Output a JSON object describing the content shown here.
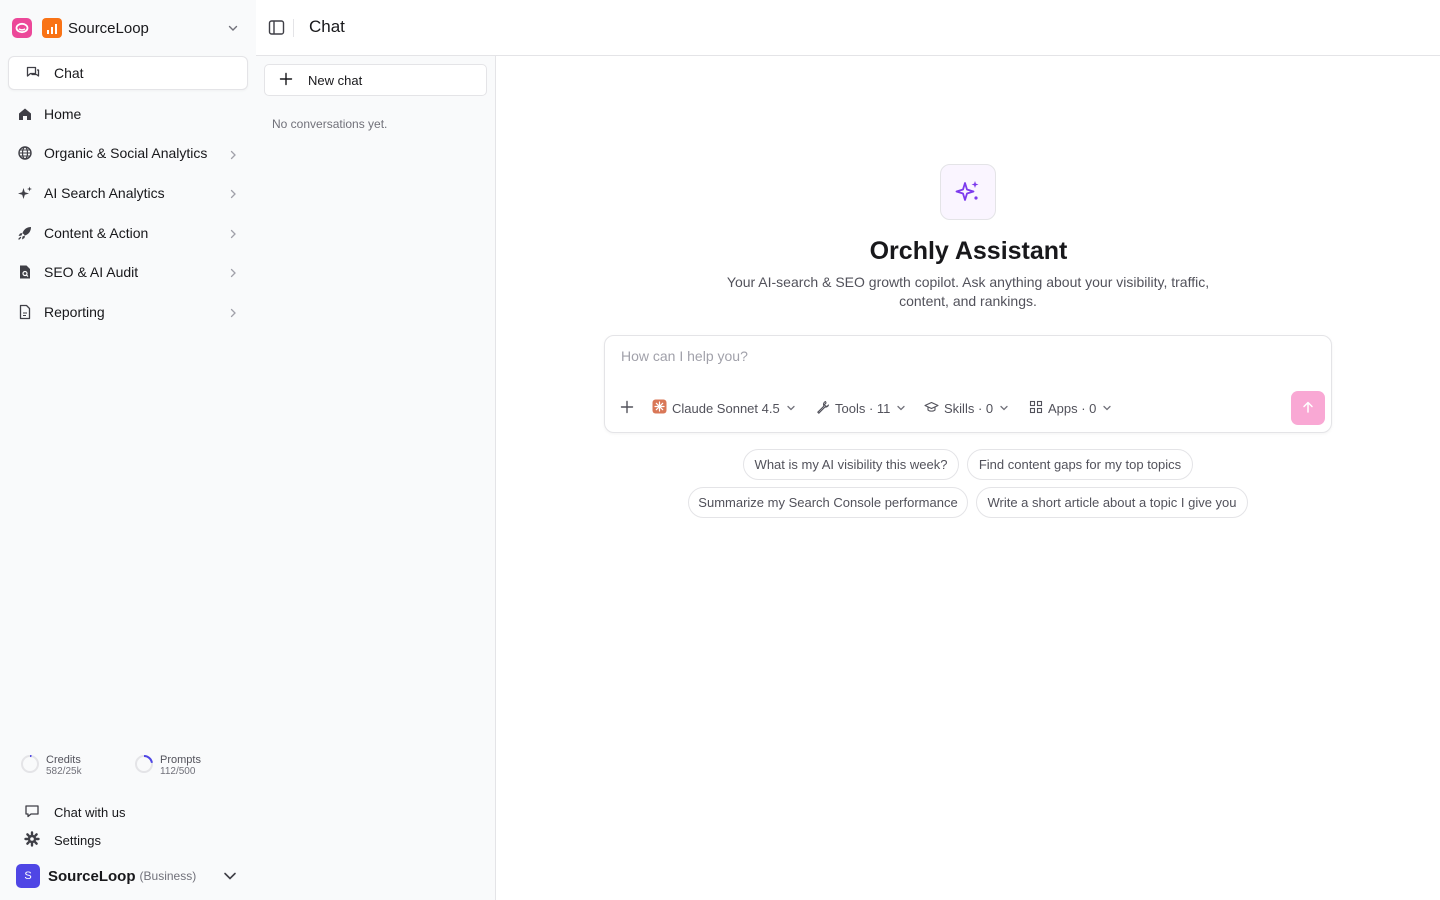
{
  "workspace": {
    "name": "SourceLoop"
  },
  "sidebar": {
    "active": {
      "label": "Chat",
      "icon": "chat-bubbles-icon"
    },
    "items": [
      {
        "label": "Home",
        "icon": "home-icon"
      },
      {
        "label": "Organic & Social Analytics",
        "icon": "globe-icon",
        "expandable": true
      },
      {
        "label": "AI Search Analytics",
        "icon": "sparkles-icon",
        "expandable": true
      },
      {
        "label": "Content & Action",
        "icon": "rocket-icon",
        "expandable": true
      },
      {
        "label": "SEO & AI Audit",
        "icon": "file-search-icon",
        "expandable": true
      },
      {
        "label": "Reporting",
        "icon": "document-icon",
        "expandable": true
      }
    ],
    "usage": {
      "credits": {
        "label": "Credits",
        "value": "582/25k",
        "fraction": 0.02328
      },
      "prompts": {
        "label": "Prompts",
        "value": "112/500",
        "fraction": 0.224
      }
    },
    "footer": {
      "chat_with_us": "Chat with us",
      "settings": "Settings"
    },
    "account": {
      "initial": "S",
      "name": "SourceLoop",
      "plan": "(Business)"
    }
  },
  "header": {
    "title": "Chat"
  },
  "conversations": {
    "new_chat": "New chat",
    "empty": "No conversations yet."
  },
  "assistant": {
    "title": "Orchly Assistant",
    "subtitle": "Your AI-search & SEO growth copilot. Ask anything about your visibility, traffic, content, and rankings."
  },
  "composer": {
    "placeholder": "How can I help you?",
    "model": "Claude Sonnet 4.5",
    "tools": "Tools · 11",
    "skills": "Skills · 0",
    "apps": "Apps · 0"
  },
  "suggestions": [
    "What is my AI visibility this week?",
    "Find content gaps for my top topics",
    "Summarize my Search Console performance",
    "Write a short article about a topic I give you"
  ],
  "colors": {
    "accent": "#ec4899",
    "send_button": "#f9a8d4",
    "hero_icon": "#7c3aed",
    "brand": "#f97316",
    "avatar": "#4f46e5"
  }
}
